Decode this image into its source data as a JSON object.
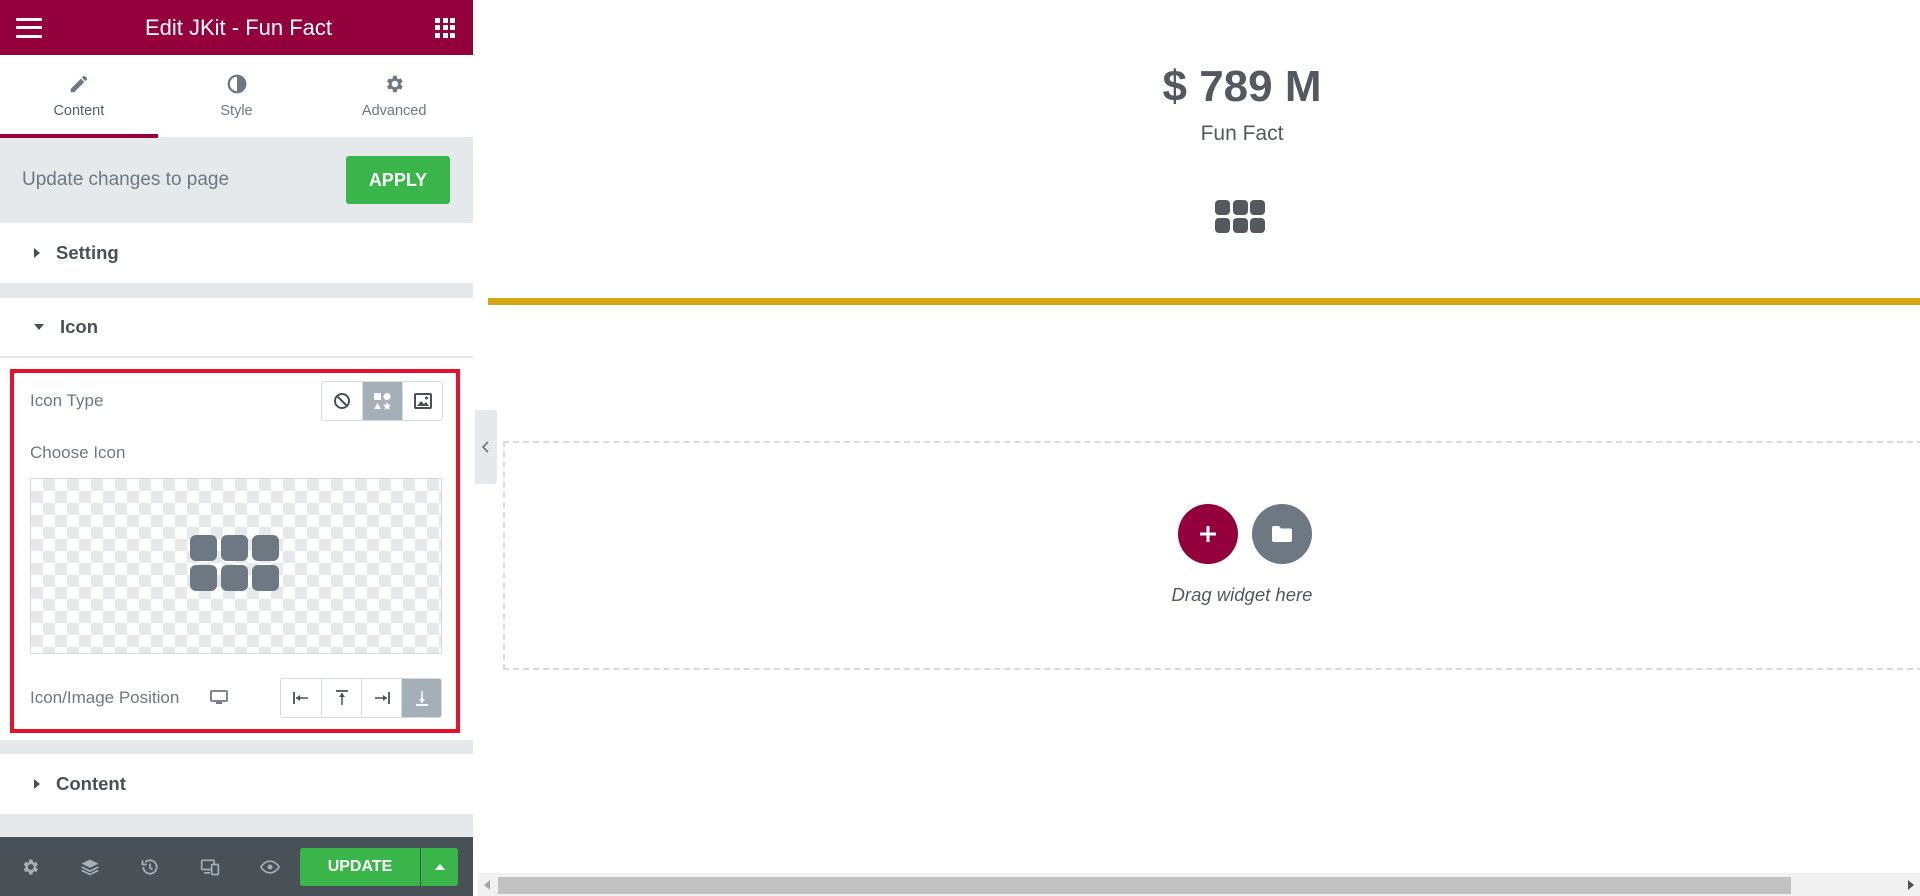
{
  "header": {
    "title": "Edit JKit - Fun Fact",
    "menu_icon": "hamburger-icon",
    "apps_icon": "grid-icon"
  },
  "tabs": [
    {
      "label": "Content",
      "icon": "pencil-icon",
      "active": true
    },
    {
      "label": "Style",
      "icon": "half-circle-icon",
      "active": false
    },
    {
      "label": "Advanced",
      "icon": "gear-icon",
      "active": false
    }
  ],
  "apply_bar": {
    "text": "Update changes to page",
    "button_label": "APPLY"
  },
  "sections": {
    "setting": {
      "label": "Setting",
      "expanded": false
    },
    "icon": {
      "label": "Icon",
      "expanded": true
    },
    "content": {
      "label": "Content",
      "expanded": false
    }
  },
  "icon_controls": {
    "icon_type_label": "Icon Type",
    "icon_type_options": [
      "none-icon",
      "icon-library-icon",
      "image-icon"
    ],
    "icon_type_selected": "icon-library-icon",
    "choose_icon_label": "Choose Icon",
    "position_label": "Icon/Image Position",
    "position_options": [
      "align-left-icon",
      "align-top-icon",
      "align-right-icon",
      "align-bottom-icon"
    ],
    "position_selected": "align-bottom-icon"
  },
  "footer": {
    "icons": [
      "settings-icon",
      "navigator-icon",
      "history-icon",
      "responsive-icon",
      "preview-eye-icon"
    ],
    "update_label": "UPDATE"
  },
  "preview": {
    "number": "$ 789 M",
    "title": "Fun Fact",
    "drop_text": "Drag widget here"
  },
  "colors": {
    "brand": "#93003c",
    "green": "#39b54a",
    "gold": "#d4a712",
    "highlight": "#e8112d"
  }
}
